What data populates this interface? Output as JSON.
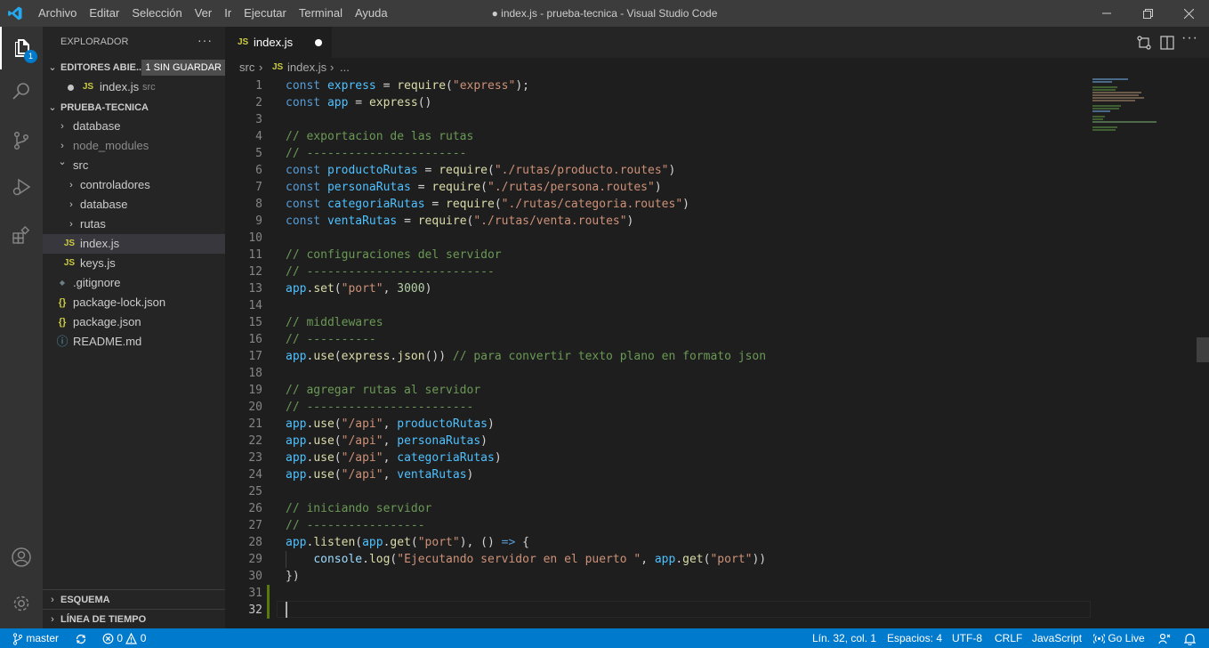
{
  "titlebar": {
    "menu": [
      "Archivo",
      "Editar",
      "Selección",
      "Ver",
      "Ir",
      "Ejecutar",
      "Terminal",
      "Ayuda"
    ],
    "title": "● index.js - prueba-tecnica - Visual Studio Code"
  },
  "activity_bar": {
    "explorer_badge": "1"
  },
  "sidebar": {
    "title": "EXPLORADOR",
    "more": "···",
    "open_editors": {
      "label": "EDITORES ABIE...",
      "unsaved_badge": "1 SIN GUARDAR",
      "files": [
        {
          "icon": "JS",
          "name": "index.js",
          "dir": "src"
        }
      ]
    },
    "project": {
      "label": "PRUEBA-TECNICA",
      "items": [
        {
          "name": "database",
          "icon": "›"
        },
        {
          "name": "node_modules",
          "icon": "›"
        },
        {
          "name": "src",
          "icon": "⌄"
        },
        {
          "name": "controladores",
          "icon": "›"
        },
        {
          "name": "database",
          "icon": "›"
        },
        {
          "name": "rutas",
          "icon": "›"
        },
        {
          "name": "index.js",
          "icon": "JS"
        },
        {
          "name": "keys.js",
          "icon": "JS"
        },
        {
          "name": ".gitignore",
          "icon": "◆"
        },
        {
          "name": "package-lock.json",
          "icon": "{}"
        },
        {
          "name": "package.json",
          "icon": "{}"
        },
        {
          "name": "README.md",
          "icon": "ⓘ"
        }
      ]
    },
    "outline_label": "ESQUEMA",
    "timeline_label": "LÍNEA DE TIEMPO"
  },
  "tabs": [
    {
      "icon": "JS",
      "label": "index.js"
    }
  ],
  "breadcrumb": {
    "folder": "src",
    "sep": "›",
    "icon": "JS",
    "file": "index.js",
    "more": "..."
  },
  "editor": {
    "line_numbers": [
      "1",
      "2",
      "3",
      "4",
      "5",
      "6",
      "7",
      "8",
      "9",
      "10",
      "11",
      "12",
      "13",
      "14",
      "15",
      "16",
      "17",
      "18",
      "19",
      "20",
      "21",
      "22",
      "23",
      "24",
      "25",
      "26",
      "27",
      "28",
      "29",
      "30",
      "31",
      "32"
    ]
  },
  "statusbar": {
    "branch": "master",
    "errors": "0",
    "warnings": "0",
    "position": "Lín. 32, col. 1",
    "spaces": "Espacios: 4",
    "encoding": "UTF-8",
    "eol": "CRLF",
    "language": "JavaScript",
    "golive": "Go Live"
  }
}
